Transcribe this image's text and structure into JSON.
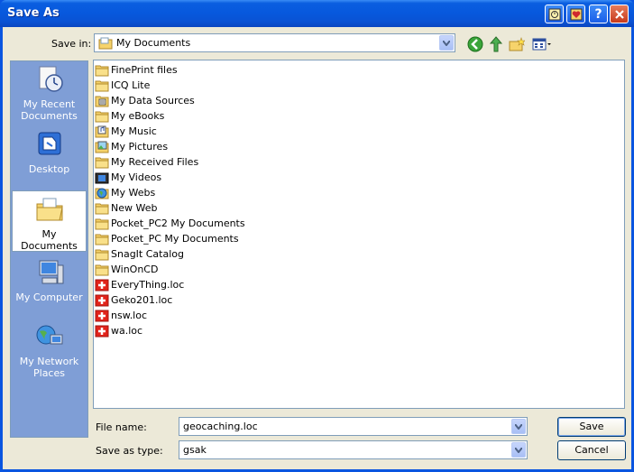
{
  "window": {
    "title": "Save As"
  },
  "save_in": {
    "label": "Save in:",
    "value": "My Documents"
  },
  "places": [
    {
      "name": "recent",
      "label": "My Recent Documents",
      "icon": "recent-documents-icon"
    },
    {
      "name": "desktop",
      "label": "Desktop",
      "icon": "desktop-icon"
    },
    {
      "name": "my-documents",
      "label": "My Documents",
      "icon": "my-documents-icon",
      "selected": true
    },
    {
      "name": "my-computer",
      "label": "My Computer",
      "icon": "computer-icon"
    },
    {
      "name": "network",
      "label": "My Network Places",
      "icon": "network-icon"
    }
  ],
  "files": [
    {
      "name": "FinePrint files",
      "icon": "folder"
    },
    {
      "name": "ICQ Lite",
      "icon": "folder"
    },
    {
      "name": "My Data Sources",
      "icon": "folder-data"
    },
    {
      "name": "My eBooks",
      "icon": "folder"
    },
    {
      "name": "My Music",
      "icon": "folder-music"
    },
    {
      "name": "My Pictures",
      "icon": "folder-pictures"
    },
    {
      "name": "My Received Files",
      "icon": "folder"
    },
    {
      "name": "My Videos",
      "icon": "folder-videos"
    },
    {
      "name": "My Webs",
      "icon": "folder-webs"
    },
    {
      "name": "New Web",
      "icon": "folder"
    },
    {
      "name": "Pocket_PC2 My Documents",
      "icon": "folder"
    },
    {
      "name": "Pocket_PC My Documents",
      "icon": "folder"
    },
    {
      "name": "SnagIt Catalog",
      "icon": "folder"
    },
    {
      "name": "WinOnCD",
      "icon": "folder"
    },
    {
      "name": "EveryThing.loc",
      "icon": "loc-file"
    },
    {
      "name": "Geko201.loc",
      "icon": "loc-file"
    },
    {
      "name": "nsw.loc",
      "icon": "loc-file"
    },
    {
      "name": "wa.loc",
      "icon": "loc-file"
    }
  ],
  "file_name": {
    "label": "File name:",
    "value": "geocaching.loc"
  },
  "save_type": {
    "label": "Save as type:",
    "value": "gsak"
  },
  "buttons": {
    "save": "Save",
    "cancel": "Cancel"
  },
  "colors": {
    "titlebar": "#0a5ee0",
    "panel": "#ece9d8",
    "places_bg": "#7f9ed6",
    "border": "#7f9db9"
  }
}
